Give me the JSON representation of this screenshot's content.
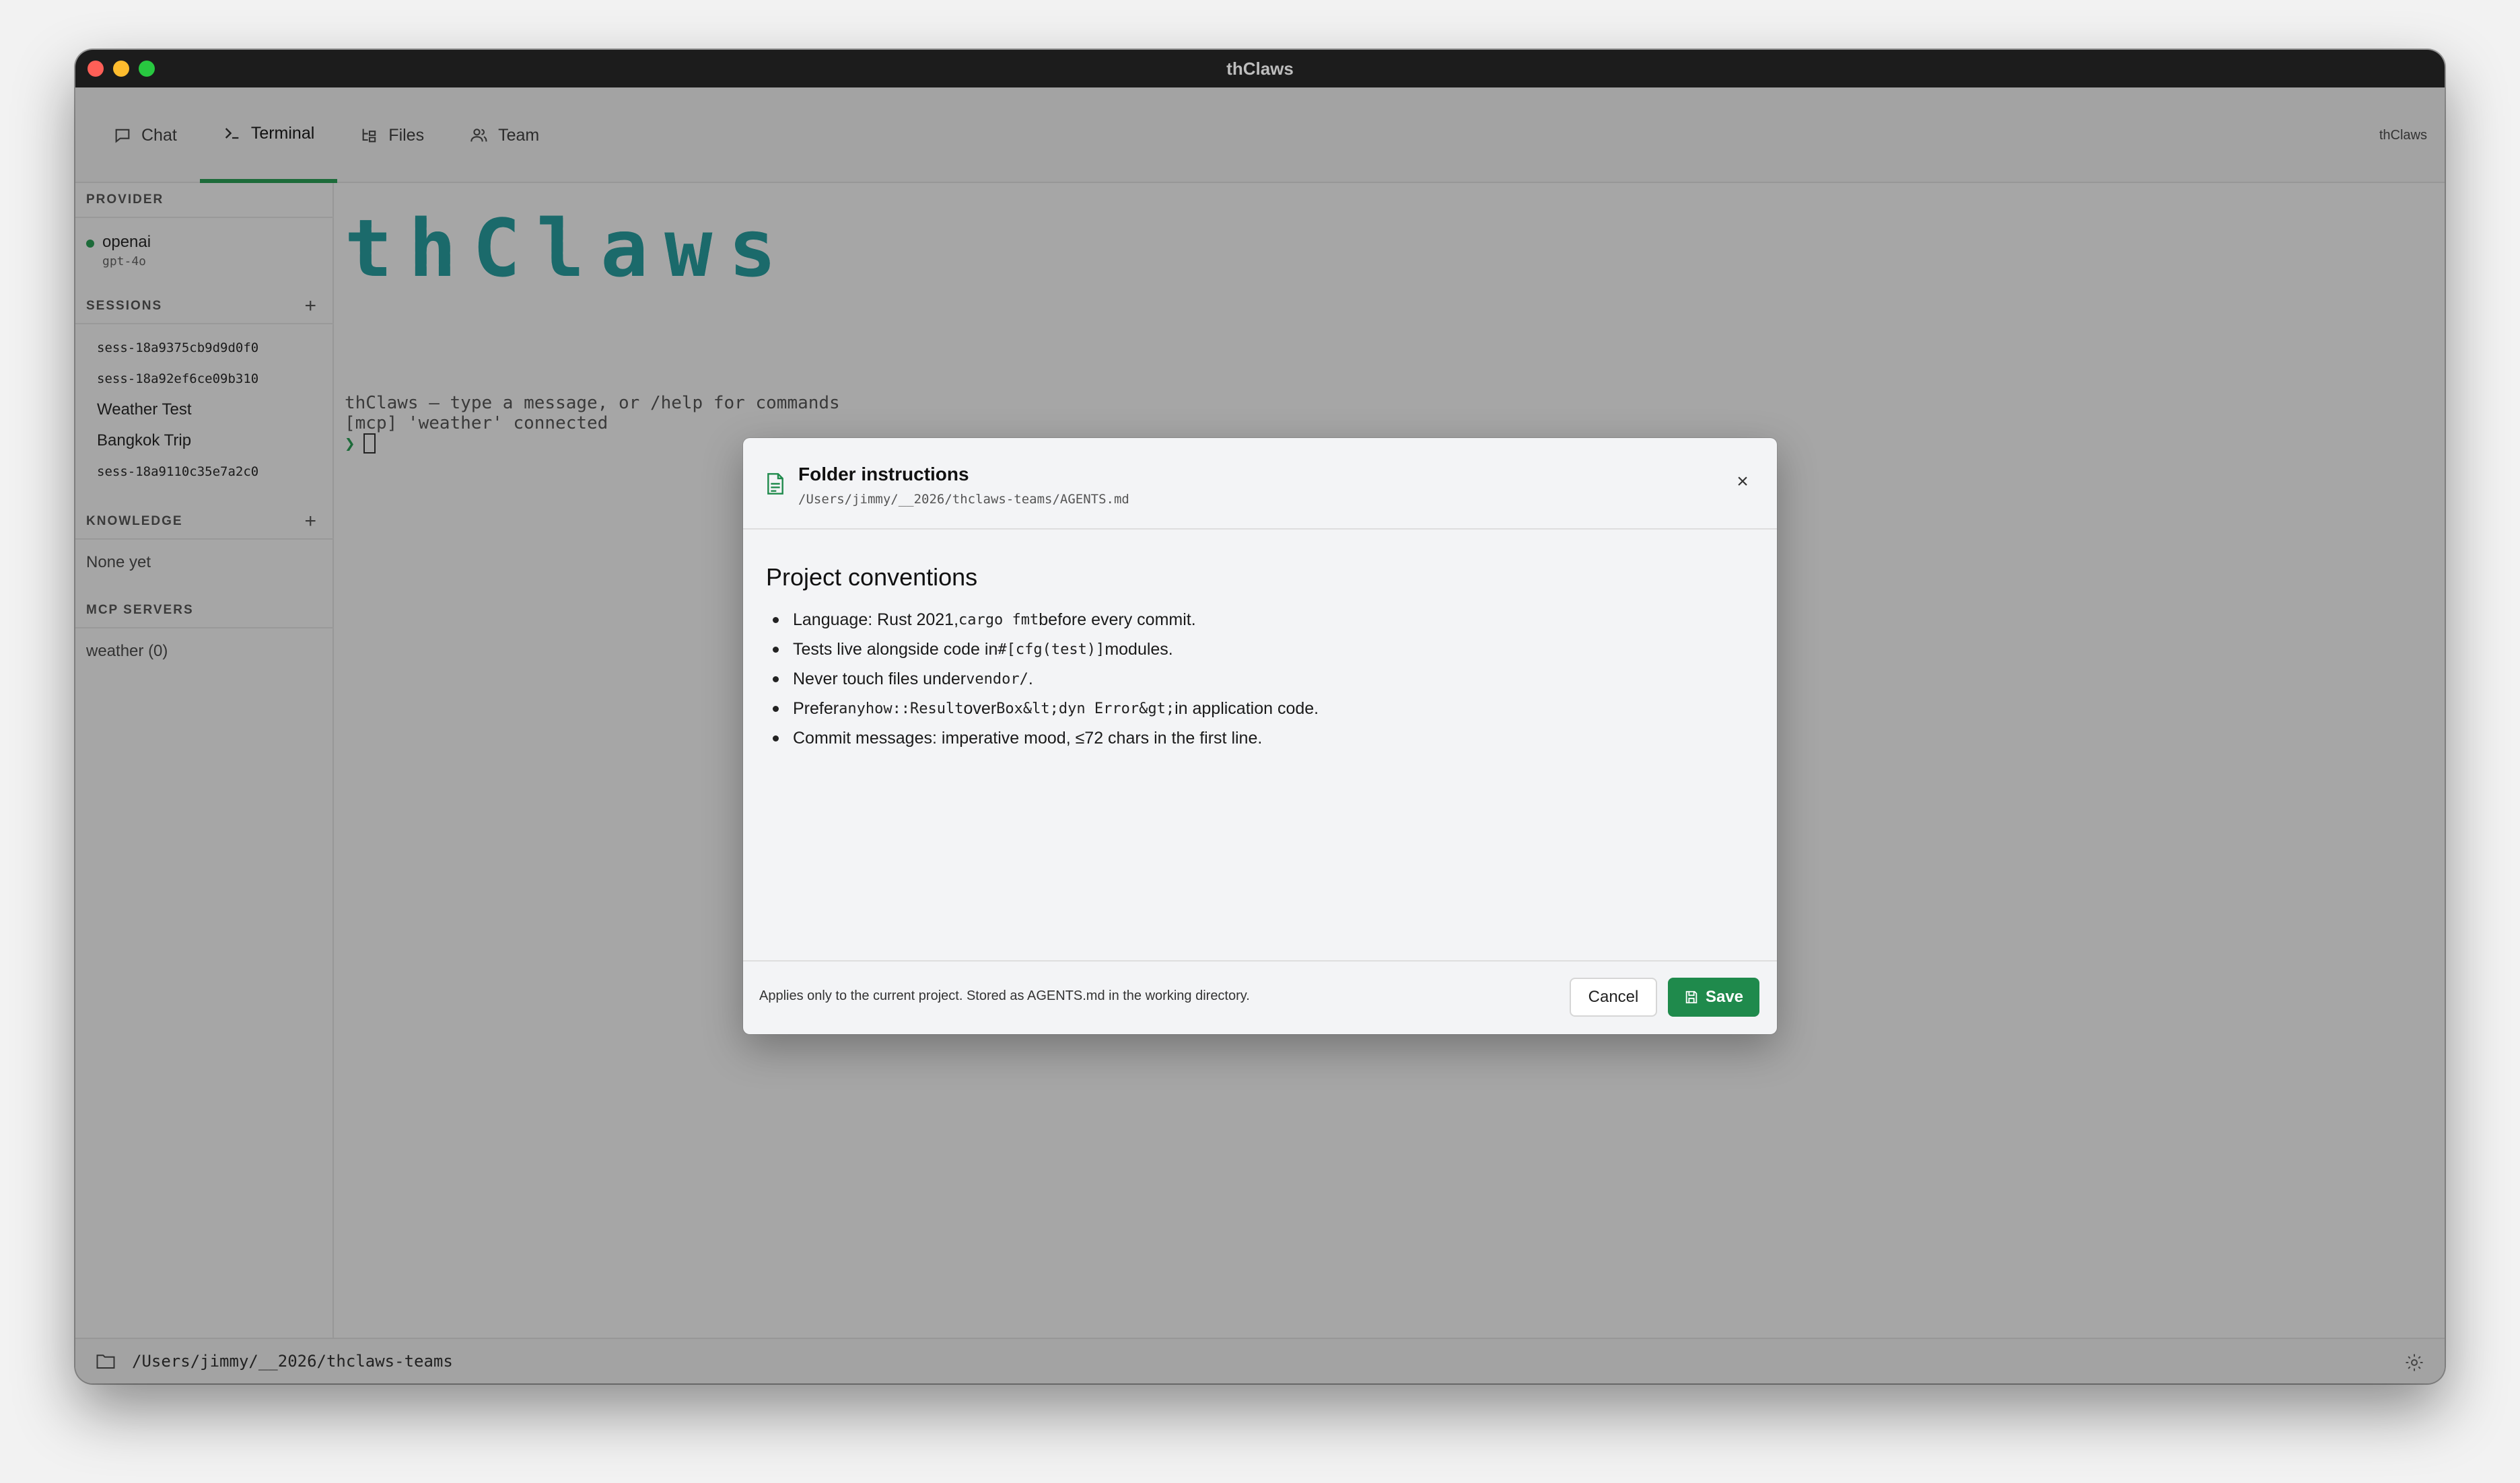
{
  "window": {
    "title": "thClaws",
    "right_label": "thClaws"
  },
  "tabs": [
    {
      "label": "Chat",
      "icon": "chat-bubble-icon",
      "active": false
    },
    {
      "label": "Terminal",
      "icon": "terminal-prompt-icon",
      "active": true
    },
    {
      "label": "Files",
      "icon": "file-tree-icon",
      "active": false
    },
    {
      "label": "Team",
      "icon": "users-icon",
      "active": false
    }
  ],
  "sidebar": {
    "provider": {
      "heading": "PROVIDER",
      "name": "openai",
      "model": "gpt-4o"
    },
    "sessions": {
      "heading": "SESSIONS",
      "add_label": "+",
      "items": [
        "sess-18a9375cb9d9d0f0",
        "sess-18a92ef6ce09b310",
        "Weather Test",
        "Bangkok Trip",
        "sess-18a9110c35e7a2c0"
      ]
    },
    "knowledge": {
      "heading": "KNOWLEDGE",
      "add_label": "+",
      "empty": "None yet"
    },
    "mcp": {
      "heading": "MCP SERVERS",
      "name": "weather",
      "count": "(0)"
    }
  },
  "terminal": {
    "logo_text": "thClaws",
    "line1": "thClaws — type a message, or /help for commands",
    "line2": "[mcp] 'weather' connected",
    "prompt_symbol": "❯"
  },
  "footer": {
    "path": "/Users/jimmy/__2026/thclaws-teams"
  },
  "modal": {
    "title": "Folder instructions",
    "path": "/Users/jimmy/__2026/thclaws-teams/AGENTS.md",
    "heading": "Project conventions",
    "items": [
      {
        "pre": "Language: Rust 2021, ",
        "code": "cargo fmt",
        "post": " before every commit."
      },
      {
        "pre": "Tests live alongside code in ",
        "code": "#[cfg(test)]",
        "post": " modules."
      },
      {
        "pre": "Never touch files under ",
        "code": "vendor/",
        "post": "."
      },
      {
        "pre": "Prefer ",
        "code": "anyhow::Result",
        "mid": " over ",
        "code2": "Box&lt;dyn Error&gt;",
        "post": " in application code."
      },
      {
        "pre": "Commit messages: imperative mood, ≤72 chars in the first line.",
        "code": "",
        "post": ""
      }
    ],
    "note": "Applies only to the current project. Stored as AGENTS.md in the working directory.",
    "cancel_label": "Cancel",
    "save_label": "Save",
    "accent_color": "#1f8a4c"
  }
}
